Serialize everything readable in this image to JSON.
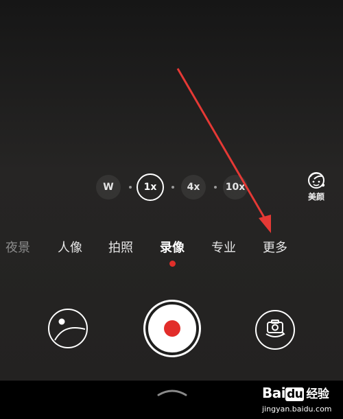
{
  "zoom": {
    "options": [
      "W",
      "1x",
      "4x",
      "10x"
    ],
    "active": "1x"
  },
  "beauty": {
    "label": "美颜",
    "icon": "beauty-face-icon"
  },
  "modes": {
    "items": [
      "夜景",
      "人像",
      "拍照",
      "录像",
      "专业",
      "更多"
    ],
    "active": "录像"
  },
  "controls": {
    "gallery_icon": "gallery-thumbnail-icon",
    "record_icon": "record-button-icon",
    "flip_icon": "camera-flip-icon"
  },
  "nav": {
    "chevron_icon": "chevron-up-icon"
  },
  "watermark": {
    "logo_bai": "Bai",
    "logo_du": "du",
    "brand": "经验",
    "url": "jingyan.baidu.com"
  },
  "colors": {
    "accent_red": "#e02f2a",
    "annotation_arrow": "#e53935"
  }
}
